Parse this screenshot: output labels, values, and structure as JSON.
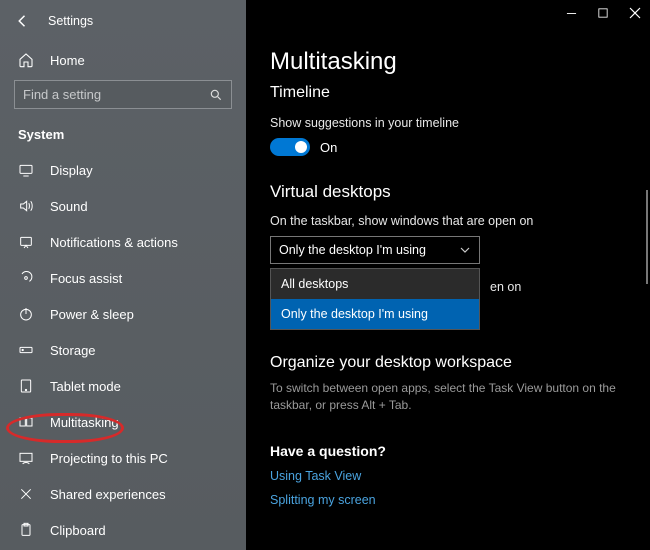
{
  "app": {
    "title": "Settings"
  },
  "sidebar": {
    "home": "Home",
    "search_placeholder": "Find a setting",
    "section": "System",
    "items": [
      {
        "label": "Display"
      },
      {
        "label": "Sound"
      },
      {
        "label": "Notifications & actions"
      },
      {
        "label": "Focus assist"
      },
      {
        "label": "Power & sleep"
      },
      {
        "label": "Storage"
      },
      {
        "label": "Tablet mode"
      },
      {
        "label": "Multitasking"
      },
      {
        "label": "Projecting to this PC"
      },
      {
        "label": "Shared experiences"
      },
      {
        "label": "Clipboard"
      }
    ]
  },
  "main": {
    "title": "Multitasking",
    "timeline": {
      "heading": "Timeline",
      "suggestion_label": "Show suggestions in your timeline",
      "toggle_state": "On"
    },
    "virtual_desktops": {
      "heading": "Virtual desktops",
      "taskbar_label": "On the taskbar, show windows that are open on",
      "selected": "Only the desktop I'm using",
      "options": [
        "All desktops",
        "Only the desktop I'm using"
      ],
      "behind_fragment": "en on"
    },
    "organize": {
      "heading": "Organize your desktop workspace",
      "help": "To switch between open apps, select the Task View button on the taskbar, or press Alt + Tab."
    },
    "question": {
      "heading": "Have a question?",
      "links": [
        "Using Task View",
        "Splitting my screen"
      ]
    }
  }
}
